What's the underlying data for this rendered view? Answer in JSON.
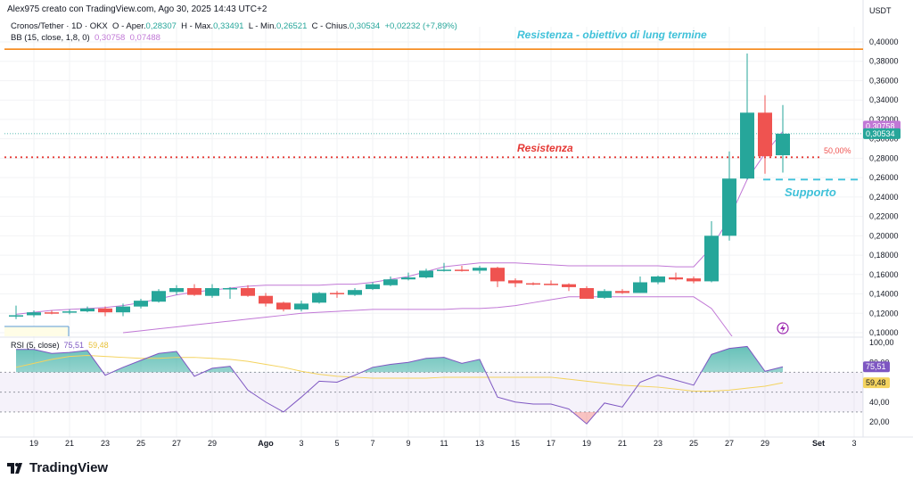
{
  "header": {
    "text": "Alex975 creato con TradingView.com, Ago 30, 2025 14:43 UTC+2"
  },
  "legend": {
    "symbol": "Cronos/Tether · 1D · OKX",
    "open_label": "O - Aper.",
    "open": "0,28307",
    "high_label": "H - Max.",
    "high": "0,33491",
    "low_label": "L - Min.",
    "low": "0,26521",
    "close_label": "C - Chius.",
    "close": "0,30534",
    "change": "+0,02232 (+7,89%)",
    "bb_label": "BB (15, close, 1,8, 0)",
    "bb_upper": "0,30758",
    "bb_lower": "0,07488"
  },
  "rsi_legend": {
    "label": "RSI (5, close)",
    "rsi": "75,51",
    "ma": "59,48"
  },
  "annotations": {
    "long_term": "Resistenza - obiettivo di lung termine",
    "resistance": "Resistenza",
    "support": "Supporto",
    "fib": "50,00%"
  },
  "colors": {
    "up": "#26a69a",
    "down": "#ef5350",
    "bb": "#c178d6",
    "rsi": "#7e57c2",
    "rsi_ma": "#f4d35e",
    "orange": "#f57c00",
    "cyan": "#3fc1d9",
    "red_line": "#e53935"
  },
  "footer": {
    "logo": "TradingView"
  },
  "chart_data": {
    "type": "candlestick",
    "price_axis": {
      "unit": "USDT",
      "range": [
        0.1,
        0.4
      ],
      "ticks": [
        "0,40000",
        "0,38000",
        "0,36000",
        "0,34000",
        "0,32000",
        "0,30000",
        "0,28000",
        "0,26000",
        "0,24000",
        "0,22000",
        "0,20000",
        "0,18000",
        "0,16000",
        "0,14000",
        "0,12000",
        "0,10000"
      ]
    },
    "last_labels": {
      "bb_upper": "0,30758",
      "close": "0,30534"
    },
    "x_ticks": [
      {
        "day": 1,
        "label": "19"
      },
      {
        "day": 3,
        "label": "21"
      },
      {
        "day": 5,
        "label": "23"
      },
      {
        "day": 7,
        "label": "25"
      },
      {
        "day": 9,
        "label": "27"
      },
      {
        "day": 11,
        "label": "29"
      },
      {
        "day": 14,
        "label": "Ago"
      },
      {
        "day": 16,
        "label": "3"
      },
      {
        "day": 18,
        "label": "5"
      },
      {
        "day": 20,
        "label": "7"
      },
      {
        "day": 22,
        "label": "9"
      },
      {
        "day": 24,
        "label": "11"
      },
      {
        "day": 26,
        "label": "13"
      },
      {
        "day": 28,
        "label": "15"
      },
      {
        "day": 30,
        "label": "17"
      },
      {
        "day": 32,
        "label": "19"
      },
      {
        "day": 34,
        "label": "21"
      },
      {
        "day": 36,
        "label": "23"
      },
      {
        "day": 38,
        "label": "25"
      },
      {
        "day": 40,
        "label": "27"
      },
      {
        "day": 42,
        "label": "29"
      },
      {
        "day": 45,
        "label": "Set"
      },
      {
        "day": 47,
        "label": "3"
      }
    ],
    "levels": {
      "long_term_resistance": 0.3925,
      "resistance": 0.281,
      "support": 0.258
    },
    "candles": [
      [
        0.117,
        0.128,
        0.114,
        0.118
      ],
      [
        0.118,
        0.123,
        0.116,
        0.121
      ],
      [
        0.121,
        0.123,
        0.119,
        0.12
      ],
      [
        0.121,
        0.124,
        0.119,
        0.122
      ],
      [
        0.122,
        0.127,
        0.121,
        0.125
      ],
      [
        0.125,
        0.127,
        0.117,
        0.121
      ],
      [
        0.121,
        0.13,
        0.117,
        0.127
      ],
      [
        0.127,
        0.135,
        0.125,
        0.133
      ],
      [
        0.132,
        0.145,
        0.131,
        0.143
      ],
      [
        0.142,
        0.149,
        0.139,
        0.146
      ],
      [
        0.146,
        0.15,
        0.138,
        0.139
      ],
      [
        0.138,
        0.15,
        0.136,
        0.146
      ],
      [
        0.145,
        0.147,
        0.135,
        0.146
      ],
      [
        0.146,
        0.149,
        0.137,
        0.138
      ],
      [
        0.138,
        0.141,
        0.127,
        0.13
      ],
      [
        0.131,
        0.132,
        0.122,
        0.124
      ],
      [
        0.124,
        0.133,
        0.122,
        0.13
      ],
      [
        0.131,
        0.142,
        0.13,
        0.141
      ],
      [
        0.141,
        0.143,
        0.136,
        0.14
      ],
      [
        0.139,
        0.146,
        0.138,
        0.144
      ],
      [
        0.145,
        0.152,
        0.144,
        0.15
      ],
      [
        0.149,
        0.158,
        0.148,
        0.155
      ],
      [
        0.155,
        0.162,
        0.154,
        0.157
      ],
      [
        0.157,
        0.166,
        0.156,
        0.164
      ],
      [
        0.164,
        0.172,
        0.163,
        0.165
      ],
      [
        0.165,
        0.169,
        0.163,
        0.164
      ],
      [
        0.164,
        0.169,
        0.161,
        0.167
      ],
      [
        0.167,
        0.168,
        0.147,
        0.153
      ],
      [
        0.154,
        0.156,
        0.147,
        0.151
      ],
      [
        0.151,
        0.152,
        0.149,
        0.15
      ],
      [
        0.1505,
        0.154,
        0.149,
        0.15
      ],
      [
        0.15,
        0.151,
        0.143,
        0.147
      ],
      [
        0.146,
        0.148,
        0.135,
        0.135
      ],
      [
        0.136,
        0.145,
        0.135,
        0.143
      ],
      [
        0.143,
        0.145,
        0.14,
        0.141
      ],
      [
        0.141,
        0.158,
        0.141,
        0.152
      ],
      [
        0.152,
        0.159,
        0.15,
        0.158
      ],
      [
        0.157,
        0.162,
        0.154,
        0.155
      ],
      [
        0.156,
        0.158,
        0.151,
        0.153
      ],
      [
        0.153,
        0.215,
        0.152,
        0.2
      ],
      [
        0.2,
        0.287,
        0.195,
        0.259
      ],
      [
        0.259,
        0.388,
        0.258,
        0.327
      ],
      [
        0.327,
        0.345,
        0.264,
        0.282
      ],
      [
        0.28307,
        0.33491,
        0.26521,
        0.30534
      ]
    ],
    "bb_upper": [
      0.119,
      0.121,
      0.123,
      0.124,
      0.125,
      0.126,
      0.128,
      0.131,
      0.135,
      0.139,
      0.142,
      0.144,
      0.146,
      0.148,
      0.149,
      0.149,
      0.149,
      0.149,
      0.15,
      0.15,
      0.152,
      0.155,
      0.158,
      0.163,
      0.168,
      0.17,
      0.172,
      0.172,
      0.172,
      0.171,
      0.17,
      0.169,
      0.169,
      0.169,
      0.169,
      0.169,
      0.169,
      0.168,
      0.168,
      0.188,
      0.218,
      0.258,
      0.285,
      0.30758
    ],
    "bb_lower": [
      null,
      null,
      null,
      null,
      null,
      null,
      0.1,
      0.102,
      0.104,
      0.106,
      0.108,
      0.11,
      0.112,
      0.114,
      0.116,
      0.118,
      0.12,
      0.121,
      0.122,
      0.123,
      0.124,
      0.124,
      0.124,
      0.124,
      0.124,
      0.125,
      0.125,
      0.126,
      0.128,
      0.131,
      0.134,
      0.137,
      0.137,
      0.137,
      0.137,
      0.137,
      0.137,
      0.137,
      0.137,
      0.125,
      0.1,
      0.07488,
      null,
      null
    ],
    "rsi": [
      93,
      93,
      89,
      90,
      92,
      67,
      75,
      82,
      89,
      91,
      66,
      74,
      76,
      52,
      40,
      30,
      45,
      61,
      60,
      67,
      75,
      78,
      80,
      84,
      85,
      79,
      83,
      45,
      40,
      38,
      38,
      33,
      18,
      39,
      35,
      60,
      67,
      62,
      57,
      88,
      94,
      96,
      71,
      75.51
    ],
    "rsi_ma": [
      75,
      79,
      83,
      86,
      87,
      86,
      85,
      84,
      84,
      85,
      85,
      84,
      83,
      81,
      78,
      75,
      71,
      68,
      66,
      65,
      64,
      64,
      64,
      64,
      65,
      65,
      65,
      65,
      65,
      65,
      65,
      63,
      61,
      59,
      57,
      56,
      55,
      53,
      51,
      51,
      52,
      54,
      56,
      59.48
    ],
    "rsi_axis": {
      "range": [
        0,
        100
      ],
      "ticks": [
        {
          "v": 100,
          "label": "100,00"
        },
        {
          "v": 80,
          "label": "80,00"
        },
        {
          "v": 60,
          "label": "60,00"
        },
        {
          "v": 40,
          "label": "40,00"
        },
        {
          "v": 20,
          "label": "20,00"
        }
      ],
      "bands": [
        70,
        50,
        30
      ]
    }
  }
}
